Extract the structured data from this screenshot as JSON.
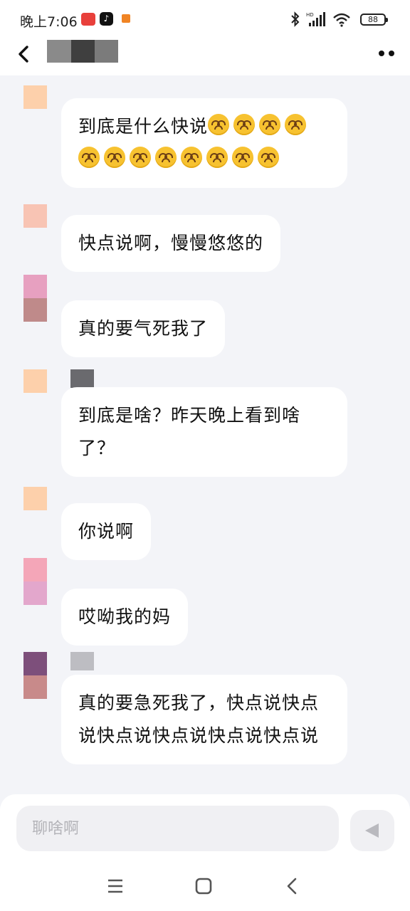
{
  "status_bar": {
    "time": "晚上7:06",
    "battery": "88",
    "icons": [
      "bluetooth-icon",
      "hd-signal-icon",
      "wifi-icon",
      "battery-icon"
    ]
  },
  "header": {
    "back_icon": "chevron-left-icon",
    "title_redacted": true,
    "more_icon": "more-dots-icon"
  },
  "messages": [
    {
      "text": "到底是什么快说",
      "emoji_count": 12,
      "emoji_name": "upside-down-face-emoji"
    },
    {
      "text": "快点说啊，慢慢悠悠的"
    },
    {
      "text": "真的要气死我了"
    },
    {
      "text": "到底是啥？昨天晚上看到啥了？"
    },
    {
      "text": "你说啊"
    },
    {
      "text": "哎呦我的妈"
    },
    {
      "text": "真的要急死我了，快点说快点说快点说快点说快点说快点说"
    }
  ],
  "composer": {
    "placeholder": "聊啥啊",
    "send_icon": "send-icon"
  },
  "system_nav": [
    "menu-icon",
    "home-icon",
    "back-icon"
  ],
  "colors": {
    "background": "#f3f4f8",
    "bubble": "#ffffff",
    "avatar_peach": "#fdd0ab",
    "avatar_pink": "#e7a0c0",
    "avatar_rose": "#bf8a8a",
    "avatar_purple": "#7d4f7b"
  }
}
